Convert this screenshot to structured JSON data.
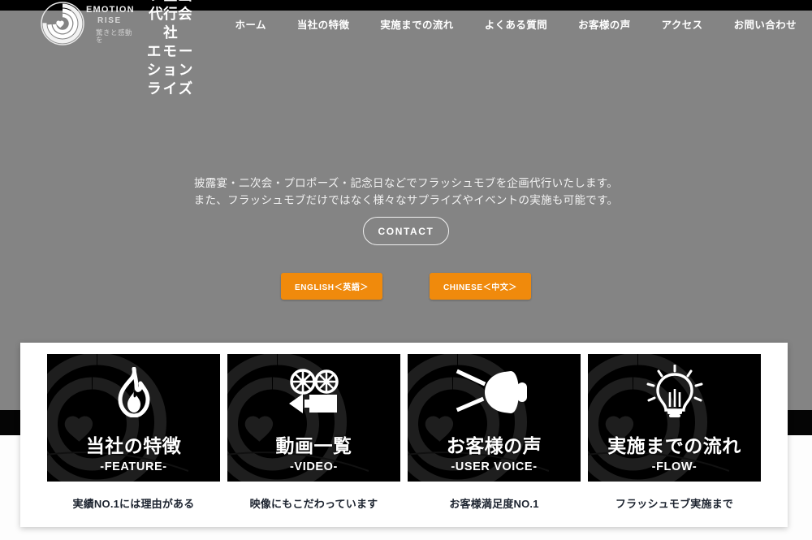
{
  "site": {
    "logo": {
      "mark_icon": "spiral-heart-logo-icon",
      "emotion_text": "EMOTION",
      "rise_text": "RISE",
      "tagline": "驚きと感動を"
    },
    "brand_title_line1": "フラッシュモブ企画代行会社",
    "brand_title_line2": "エモーションライズ"
  },
  "nav": {
    "items": [
      {
        "label": "ホーム"
      },
      {
        "label": "当社の特徴"
      },
      {
        "label": "実施までの流れ"
      },
      {
        "label": "よくある質問"
      },
      {
        "label": "お客様の声"
      },
      {
        "label": "アクセス"
      },
      {
        "label": "お問い合わせ"
      }
    ]
  },
  "hero": {
    "line1": "披露宴・二次会・プロポーズ・記念日などでフラッシュモブを企画代行いたします。",
    "line2": "また、フラッシュモブだけではなく様々なサプライズやイベントの実施も可能です。",
    "contact_button": "CONTACT",
    "lang_buttons": [
      {
        "label": "ENGLISH＜英語＞"
      },
      {
        "label": "CHINESE＜中文＞"
      }
    ]
  },
  "cards": [
    {
      "icon": "flame-icon",
      "title_jp": "当社の特徴",
      "title_en": "-FEATURE-",
      "caption": "実績NO.1には理由がある"
    },
    {
      "icon": "movie-camera-icon",
      "title_jp": "動画一覧",
      "title_en": "-VIDEO-",
      "caption": "映像にもこだわっています"
    },
    {
      "icon": "megaphone-icon",
      "title_jp": "お客様の声",
      "title_en": "-USER VOICE-",
      "caption": "お客様満足度NO.1"
    },
    {
      "icon": "lightbulb-icon",
      "title_jp": "実施までの流れ",
      "title_en": "-FLOW-",
      "caption": "フラッシュモブ実施まで"
    }
  ],
  "colors": {
    "hero_bg": "#848484",
    "accent_orange": "#f08a0c",
    "card_bg": "#000000",
    "band_black": "#050505",
    "panel_white": "#ffffff"
  }
}
